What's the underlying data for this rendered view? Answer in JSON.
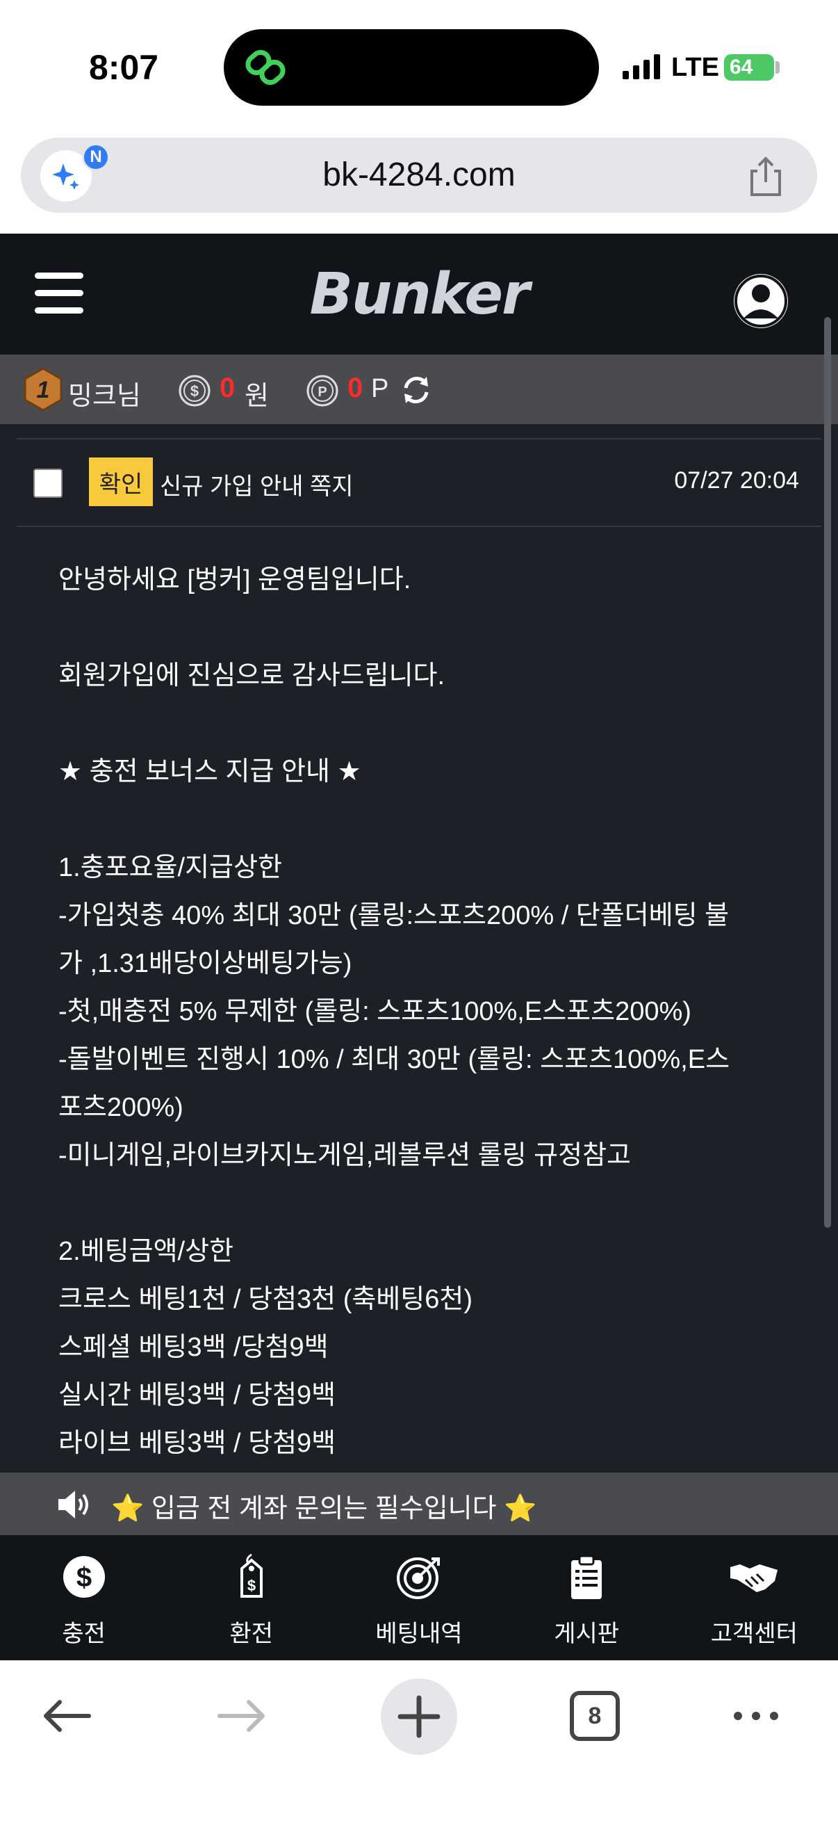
{
  "status_bar": {
    "time": "8:07",
    "network": "LTE",
    "battery": "64"
  },
  "browser": {
    "url": "bk-4284.com",
    "ai_badge": "N",
    "tab_count": "8"
  },
  "site": {
    "logo": "Bunker"
  },
  "user": {
    "level": "1",
    "nickname": "밍크님",
    "money_value": "0",
    "money_unit": "원",
    "point_value": "0",
    "point_unit": "P"
  },
  "message": {
    "status_badge": "확인",
    "title": "신규 가입 안내 쪽지",
    "date": "07/27 20:04",
    "body_lines": [
      "안녕하세요 [벙커] 운영팀입니다.",
      "",
      "회원가입에 진심으로 감사드립니다.",
      "",
      "★ 충전 보너스 지급 안내 ★",
      "",
      "1.충포요율/지급상한",
      "-가입첫충 40% 최대 30만 (롤링:스포츠200% / 단폴더베팅 불",
      "가 ,1.31배당이상베팅가능)",
      "-첫,매충전 5% 무제한 (롤링: 스포츠100%,E스포츠200%)",
      "-돌발이벤트 진행시 10% / 최대 30만 (롤링: 스포츠100%,E스",
      "포츠200%)",
      "-미니게임,라이브카지노게임,레볼루션 롤링 규정참고",
      "",
      "2.베팅금액/상한",
      "크로스 베팅1천 / 당첨3천 (축베팅6천)",
      "스페셜 베팅3백 /당첨9백",
      "실시간 베팅3백 / 당첨9백",
      "라이브 베팅3백 / 당첨9백"
    ]
  },
  "ticker": {
    "star_left": "⭐",
    "text": "입금 전 계좌 문의는 필수입니다",
    "star_right": "⭐"
  },
  "bottom_nav": [
    {
      "label": "충전",
      "icon": "dollar-circle-icon"
    },
    {
      "label": "환전",
      "icon": "price-tag-icon"
    },
    {
      "label": "베팅내역",
      "icon": "target-icon"
    },
    {
      "label": "게시판",
      "icon": "clipboard-icon"
    },
    {
      "label": "고객센터",
      "icon": "handshake-icon"
    }
  ],
  "colors": {
    "header_bg": "#111419",
    "content_bg": "#1d2026",
    "bar_bg": "#4a4b4f",
    "badge": "#f8c93c",
    "highlight_red": "#ff2a2a",
    "battery_green": "#4cc964"
  }
}
